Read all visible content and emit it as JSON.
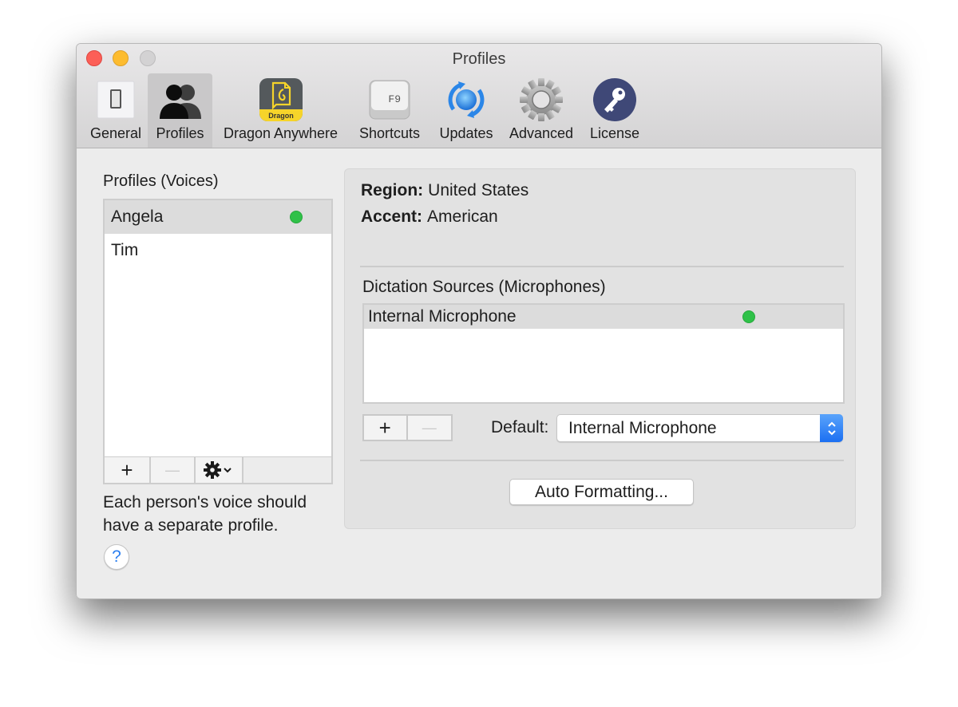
{
  "window": {
    "title": "Profiles"
  },
  "toolbar": {
    "tabs": [
      {
        "id": "general",
        "label": "General",
        "icon": "toggle-switch-icon",
        "selected": false
      },
      {
        "id": "profiles",
        "label": "Profiles",
        "icon": "users-icon",
        "selected": true
      },
      {
        "id": "dragon-anywhere",
        "label": "Dragon Anywhere",
        "icon": "dragon-app-icon",
        "icon_text": "Dragon",
        "selected": false
      },
      {
        "id": "shortcuts",
        "label": "Shortcuts",
        "icon": "f9-key-icon",
        "icon_text": "F9",
        "selected": false
      },
      {
        "id": "updates",
        "label": "Updates",
        "icon": "refresh-globe-icon",
        "selected": false
      },
      {
        "id": "advanced",
        "label": "Advanced",
        "icon": "gear-icon",
        "selected": false
      },
      {
        "id": "license",
        "label": "License",
        "icon": "key-icon",
        "selected": false
      }
    ]
  },
  "profiles": {
    "title": "Profiles (Voices)",
    "items": [
      {
        "name": "Angela",
        "selected": true,
        "active": true
      },
      {
        "name": "Tim",
        "selected": false,
        "active": false
      }
    ],
    "add_label": "+",
    "remove_label": "—",
    "help_text": "Each person's voice should have a separate profile.",
    "help_label": "?"
  },
  "details": {
    "region_label": "Region:",
    "region_value": "United States",
    "accent_label": "Accent:",
    "accent_value": "American",
    "sources_title": "Dictation Sources (Microphones)",
    "sources": [
      {
        "name": "Internal Microphone",
        "selected": true,
        "active": true
      }
    ],
    "add_label": "+",
    "remove_label": "—",
    "default_label": "Default:",
    "default_value": "Internal Microphone",
    "auto_formatting_label": "Auto Formatting..."
  },
  "colors": {
    "active_dot": "#2fc148",
    "accent_blue": "#1b6ff2",
    "close": "#fc5f57",
    "minimize": "#fdbc2f"
  }
}
